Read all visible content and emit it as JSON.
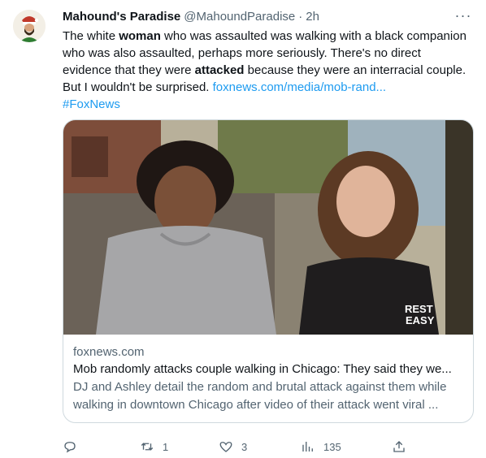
{
  "author": {
    "name": "Mahound's Paradise",
    "handle": "@MahoundParadise",
    "separator": "·",
    "time": "2h",
    "more": "···"
  },
  "tweet": {
    "t1": "The white ",
    "b1": "woman",
    "t2": " who was assaulted was walking with a black companion who was also assaulted, perhaps more seriously. There's no direct evidence that they were ",
    "b2": "attacked",
    "t3": " because they were an interracial couple. But I wouldn't be surprised. ",
    "link": "foxnews.com/media/mob-rand...",
    "hashtag": "#FoxNews"
  },
  "card": {
    "domain": "foxnews.com",
    "title": "Mob randomly attacks couple walking in Chicago: They said they we...",
    "description": "DJ and Ashley detail the random and brutal attack against them while walking in downtown Chicago after video of their attack went viral ...",
    "shirt_line1": "REST",
    "shirt_line2": "EASY"
  },
  "actions": {
    "reply_count": "",
    "retweet_count": "1",
    "like_count": "3",
    "views_count": "135"
  },
  "icons": [
    "reply-icon",
    "retweet-icon",
    "like-icon",
    "views-icon",
    "share-icon",
    "more-icon"
  ],
  "colors": {
    "link": "#1d9bf0",
    "muted": "#536471",
    "text": "#0f1419",
    "border": "#cfd9de"
  }
}
